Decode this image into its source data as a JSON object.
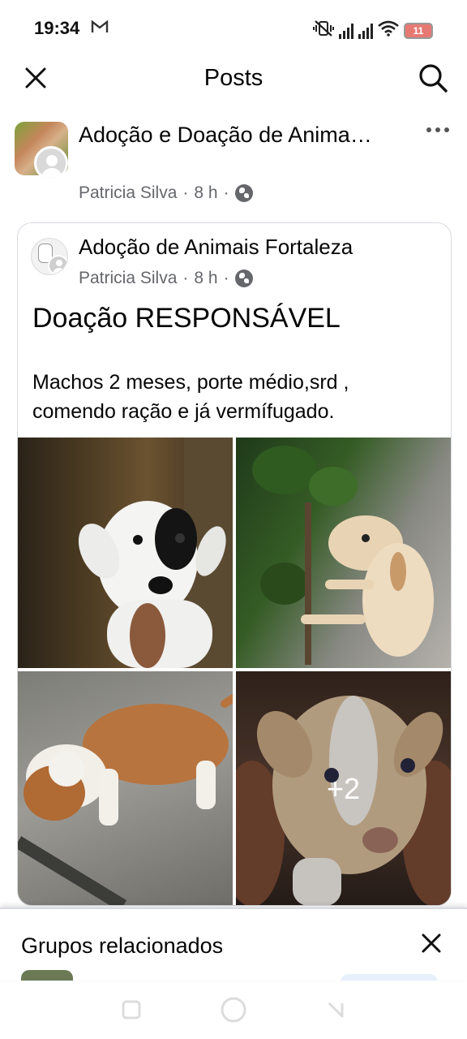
{
  "status_bar": {
    "time": "19:34",
    "mail_icon": "gmail-m-icon",
    "battery_level": "11",
    "icons": [
      "mute-vibrate-icon",
      "signal-icon",
      "signal-icon",
      "wifi-icon",
      "battery-icon"
    ]
  },
  "top_bar": {
    "title": "Posts",
    "close_icon": "close-icon",
    "search_icon": "search-icon"
  },
  "group": {
    "name": "Adoção e Doação de Anima…",
    "author": "Patricia Silva",
    "time": "8 h",
    "separator": "·",
    "more_icon": "more-dots-icon",
    "privacy_icon": "globe-icon"
  },
  "shared_post": {
    "group_name": "Adoção de Animais Fortaleza",
    "author": "Patricia Silva",
    "time": "8 h",
    "separator": "·",
    "title": "Doação RESPONSÁVEL",
    "body": "Machos 2 meses, porte médio,srd , comendo ração e já vermífugado.",
    "photos_more": "+2",
    "photos": [
      "puppy-white-black-eye-photo",
      "puppy-cream-standing-photo",
      "puppy-brown-white-photo",
      "puppy-cream-closeup-photo"
    ]
  },
  "related_groups": {
    "title": "Grupos relacionados",
    "close_icon": "close-icon"
  },
  "nav_bar": {
    "icons": [
      "recent-apps-icon",
      "home-icon",
      "back-icon"
    ]
  },
  "colors": {
    "text_primary": "#050505",
    "text_secondary": "#65676b",
    "border": "#d8dadf",
    "battery": "#e67a73"
  }
}
